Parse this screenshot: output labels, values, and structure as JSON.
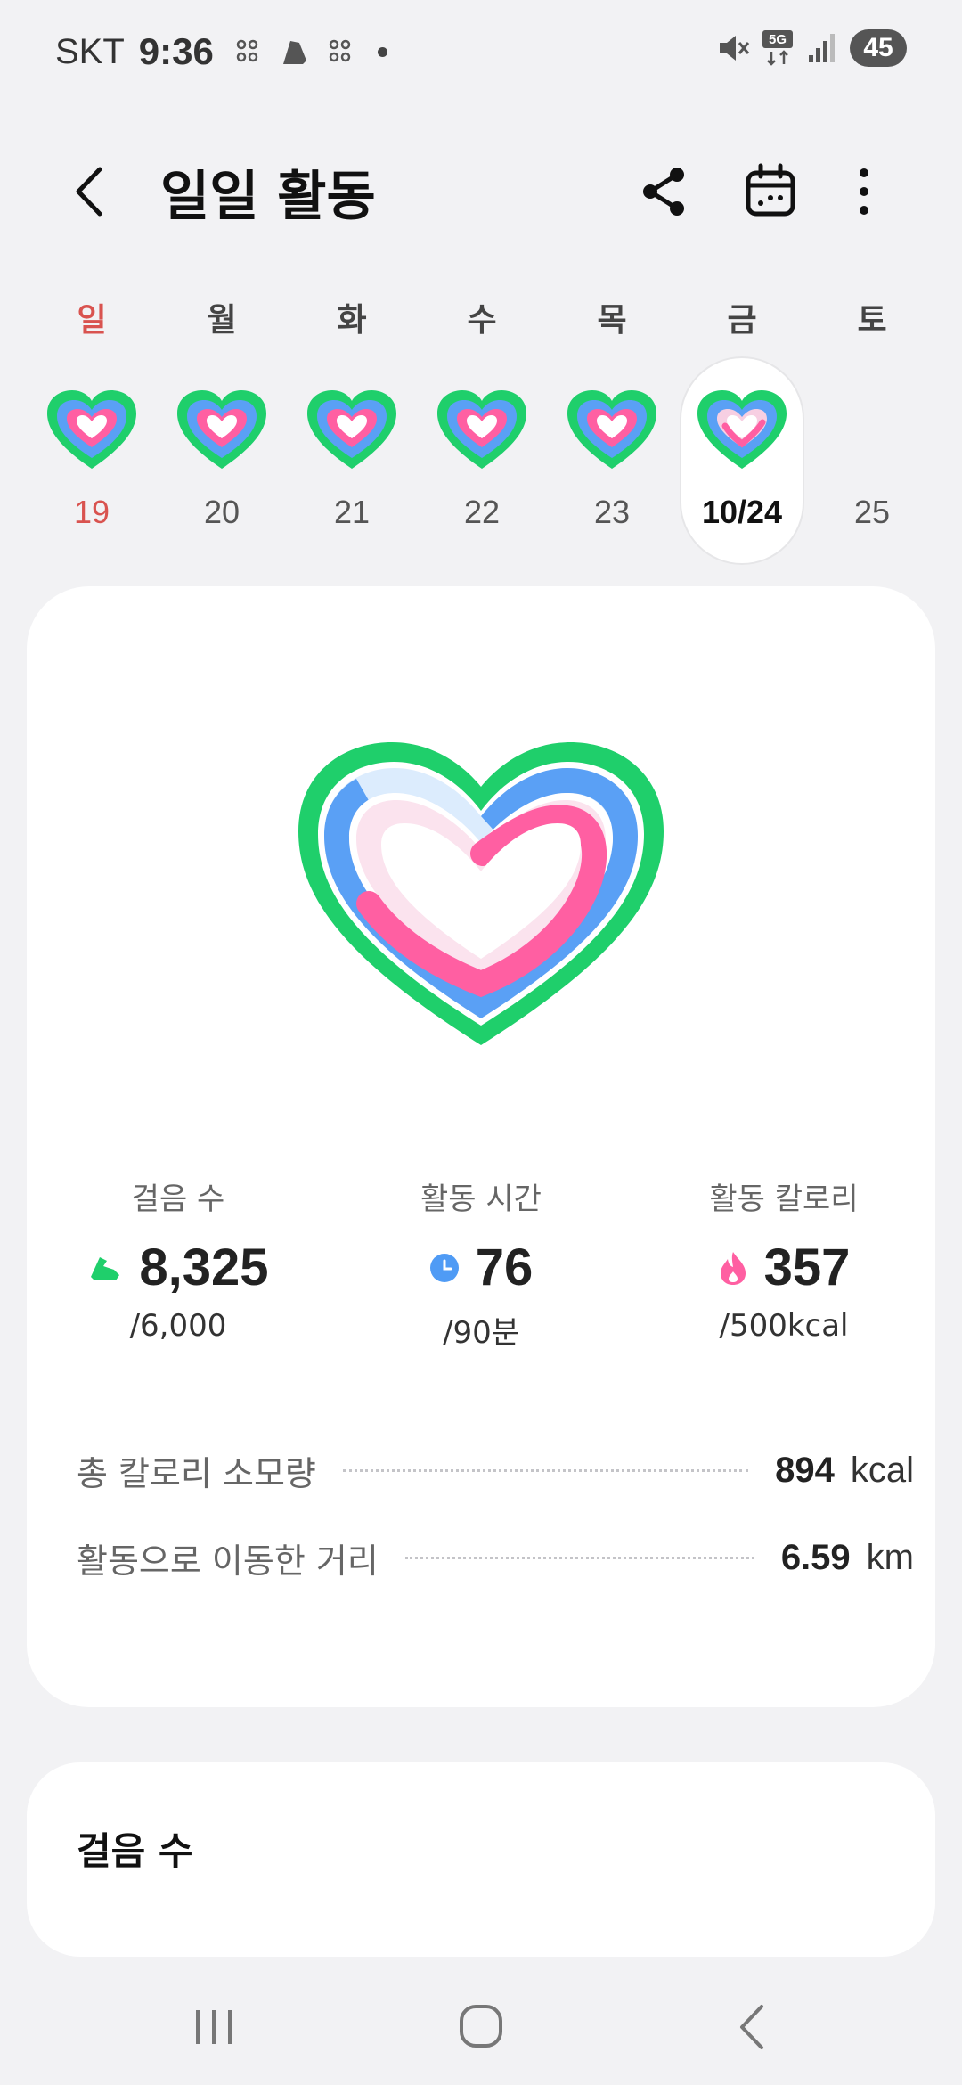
{
  "status_bar": {
    "carrier": "SKT",
    "time": "9:36",
    "battery": "45",
    "network": "5G"
  },
  "header": {
    "title": "일일 활동"
  },
  "week": [
    {
      "name": "일",
      "date": "19"
    },
    {
      "name": "월",
      "date": "20"
    },
    {
      "name": "화",
      "date": "21"
    },
    {
      "name": "수",
      "date": "22"
    },
    {
      "name": "목",
      "date": "23"
    },
    {
      "name": "금",
      "date": "10/24"
    },
    {
      "name": "토",
      "date": "25"
    }
  ],
  "activity": {
    "steps": {
      "label": "걸음 수",
      "value": "8,325",
      "goal": "/6,000"
    },
    "active_time": {
      "label": "활동 시간",
      "value": "76",
      "goal": "/90분"
    },
    "active_calories": {
      "label": "활동 칼로리",
      "value": "357",
      "goal": "/500kcal"
    }
  },
  "summary": {
    "total_calories": {
      "label": "총 칼로리 소모량",
      "value": "894",
      "unit": "kcal"
    },
    "distance": {
      "label": "활동으로 이동한 거리",
      "value": "6.59",
      "unit": "km"
    }
  },
  "steps_card": {
    "title": "걸음 수"
  },
  "colors": {
    "steps_ring": "#1fcf6b",
    "time_ring": "#5aa0f5",
    "calorie_ring": "#ff5fa2",
    "sunday": "#d9534f"
  }
}
